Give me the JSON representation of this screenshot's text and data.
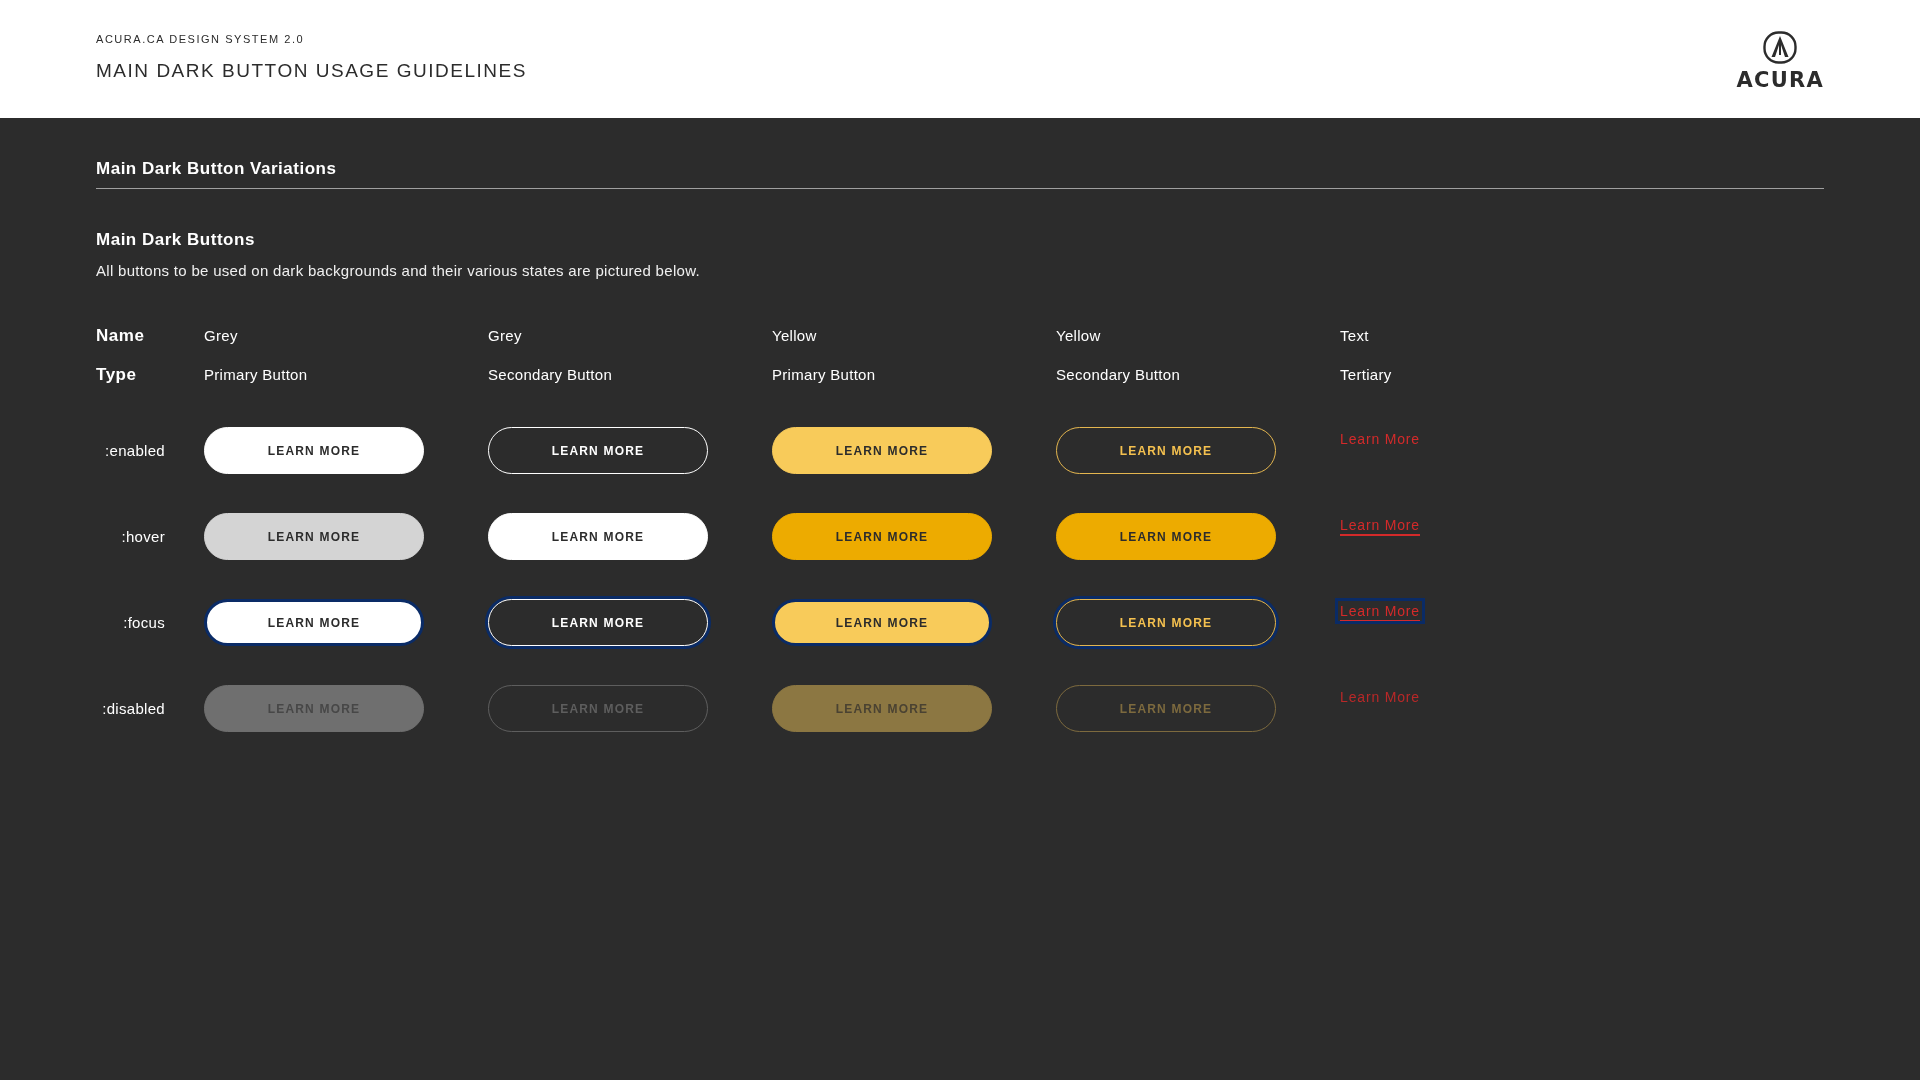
{
  "header": {
    "eyebrow": "ACURA.CA DESIGN SYSTEM 2.0",
    "title": "MAIN DARK BUTTON USAGE GUIDELINES",
    "logo_text": "ACURA"
  },
  "section": {
    "title": "Main Dark Button Variations"
  },
  "subsection": {
    "title": "Main Dark Buttons",
    "description": "All buttons to be used on dark backgrounds and their various states are pictured below."
  },
  "table": {
    "row_labels": {
      "name": "Name",
      "type": "Type"
    },
    "columns": [
      {
        "name": "Grey",
        "type": "Primary Button",
        "kind": "grey-primary"
      },
      {
        "name": "Grey",
        "type": "Secondary Button",
        "kind": "grey-secondary"
      },
      {
        "name": "Yellow",
        "type": "Primary Button",
        "kind": "yellow-primary"
      },
      {
        "name": "Yellow",
        "type": "Secondary Button",
        "kind": "yellow-secondary"
      },
      {
        "name": "Text",
        "type": "Tertiary",
        "kind": "text"
      }
    ],
    "states": [
      {
        "label": ":enabled",
        "kind": "enabled",
        "buttons": [
          "LEARN MORE",
          "LEARN MORE",
          "LEARN MORE",
          "LEARN MORE",
          "Learn More"
        ]
      },
      {
        "label": ":hover",
        "kind": "hover",
        "buttons": [
          "LEARN MORE",
          "LEARN MORE",
          "LEARN MORE",
          "LEARN MORE",
          "Learn More"
        ]
      },
      {
        "label": ":focus",
        "kind": "focus",
        "buttons": [
          "LEARN MORE",
          "LEARN MORE",
          "LEARN MORE",
          "LEARN MORE",
          "Learn More"
        ]
      },
      {
        "label": ":disabled",
        "kind": "disabled",
        "buttons": [
          "LEARN MORE",
          "LEARN MORE",
          "LEARN MORE",
          "LEARN MORE",
          "Learn More"
        ]
      }
    ]
  }
}
